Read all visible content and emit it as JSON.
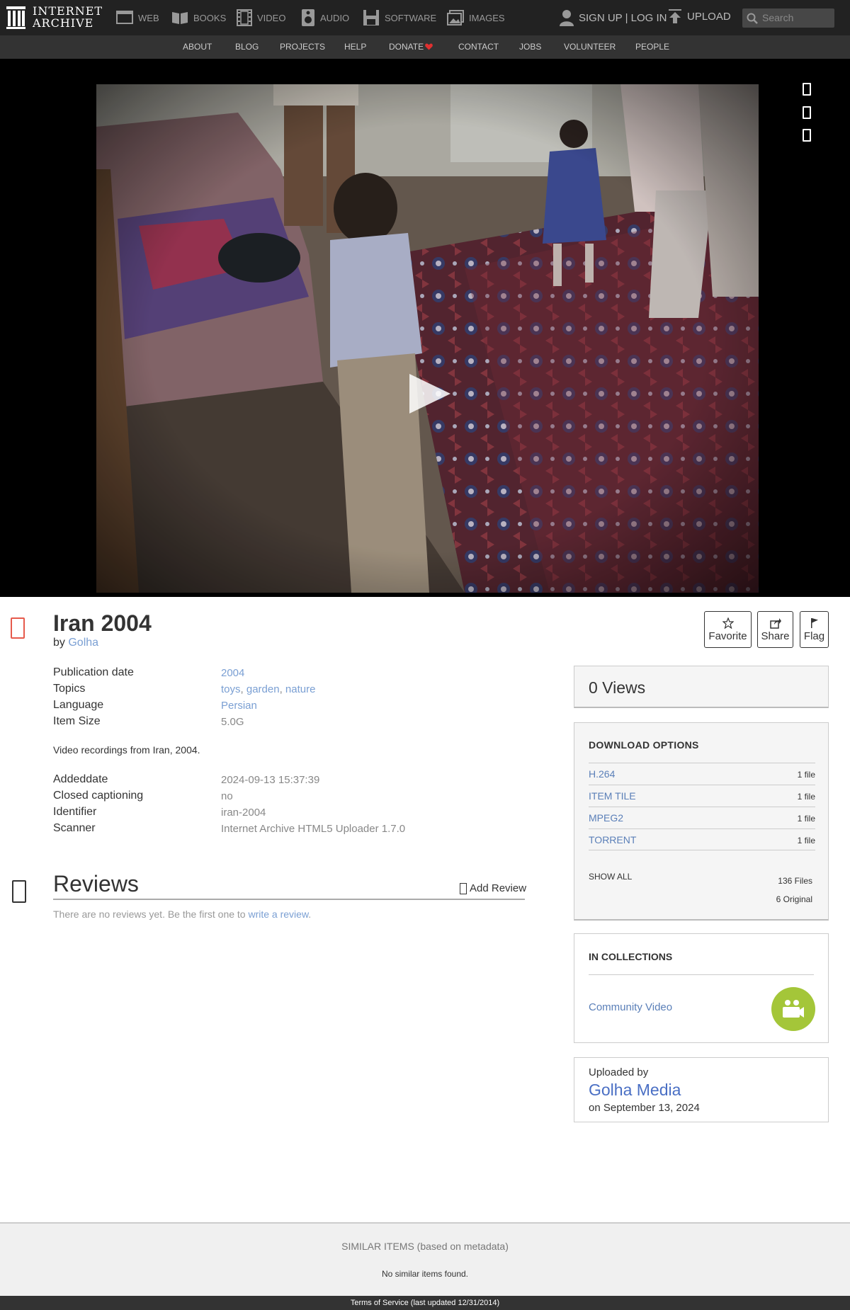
{
  "nav": {
    "logo_line1": "INTERNET",
    "logo_line2": "ARCHIVE",
    "web": "WEB",
    "books": "BOOKS",
    "video": "VIDEO",
    "audio": "AUDIO",
    "software": "SOFTWARE",
    "images": "IMAGES",
    "signup": "SIGN UP | LOG IN",
    "upload": "UPLOAD",
    "search_placeholder": "Search"
  },
  "subnav": [
    "ABOUT",
    "BLOG",
    "PROJECTS",
    "HELP",
    "DONATE",
    "CONTACT",
    "JOBS",
    "VOLUNTEER",
    "PEOPLE"
  ],
  "item": {
    "title": "Iran 2004",
    "by_label": "by",
    "creator": "Golha",
    "description": "Video recordings from Iran, 2004."
  },
  "actions": {
    "favorite": "Favorite",
    "share": "Share",
    "flag": "Flag"
  },
  "metadata": {
    "pubdate_label": "Publication date",
    "pubdate": "2004",
    "topics_label": "Topics",
    "topic1": "toys",
    "topic2": "garden",
    "topic3": "nature",
    "language_label": "Language",
    "language": "Persian",
    "size_label": "Item Size",
    "size": "5.0G",
    "added_label": "Addeddate",
    "added": "2024-09-13 15:37:39",
    "cc_label": "Closed captioning",
    "cc": "no",
    "identifier_label": "Identifier",
    "identifier": "iran-2004",
    "scanner_label": "Scanner",
    "scanner": "Internet Archive HTML5 Uploader 1.7.0"
  },
  "reviews": {
    "title": "Reviews",
    "add": "Add Review",
    "none_text": "There are no reviews yet. Be the first one to",
    "write_link": "write a review",
    "period": "."
  },
  "views": "0 Views",
  "downloads": {
    "heading": "DOWNLOAD OPTIONS",
    "rows": [
      {
        "format": "H.264",
        "count": "1 file"
      },
      {
        "format": "ITEM TILE",
        "count": "1 file"
      },
      {
        "format": "MPEG2",
        "count": "1 file"
      },
      {
        "format": "TORRENT",
        "count": "1 file"
      }
    ],
    "show_all": "SHOW ALL",
    "total_files": "136 Files",
    "original": "6 Original"
  },
  "collections": {
    "heading": "IN COLLECTIONS",
    "name": "Community Video"
  },
  "uploader": {
    "label": "Uploaded by",
    "name": "Golha Media",
    "date": "on September 13, 2024"
  },
  "similar": {
    "heading": "SIMILAR ITEMS (based on metadata)",
    "none": "No similar items found."
  },
  "footer": "Terms of Service (last updated 12/31/2014)",
  "colors": {
    "accent_red": "#e65a4c",
    "link": "#7a9fd3",
    "collection_icon": "#a4c639"
  }
}
